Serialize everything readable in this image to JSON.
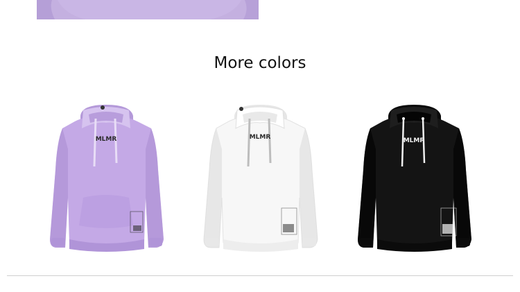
{
  "section": {
    "title": "More colors"
  },
  "top_image": {
    "description_color": "#c2aede"
  },
  "products": [
    {
      "color_name": "lavender",
      "body_color": "#c4a9e6",
      "shade_color": "#a98dcf",
      "string_color": "#e8ddf6",
      "logo_text": "MLMR",
      "logo_color": "#2b2b2b"
    },
    {
      "color_name": "white",
      "body_color": "#f7f7f7",
      "shade_color": "#dcdcdc",
      "string_color": "#bdbdbd",
      "logo_text": "MLMR",
      "logo_color": "#2b2b2b"
    },
    {
      "color_name": "black",
      "body_color": "#141414",
      "shade_color": "#000000",
      "string_color": "#f0f0f0",
      "logo_text": "MLMR",
      "logo_color": "#f2f2f2"
    }
  ]
}
